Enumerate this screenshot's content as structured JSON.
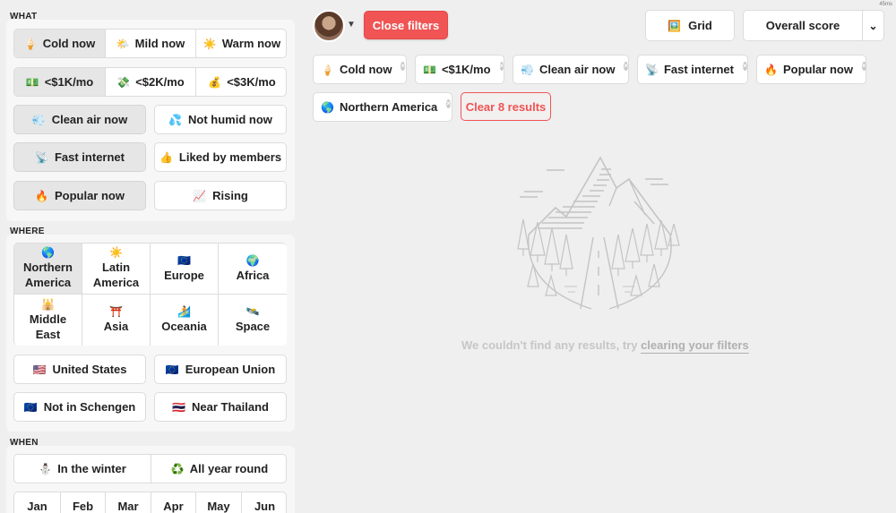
{
  "sidebar": {
    "what_label": "WHAT",
    "where_label": "WHERE",
    "when_label": "WHEN",
    "weather": [
      {
        "emoji": "🍦",
        "label": "Cold now",
        "selected": true
      },
      {
        "emoji": "🌤️",
        "label": "Mild now",
        "selected": false
      },
      {
        "emoji": "☀️",
        "label": "Warm now",
        "selected": false
      }
    ],
    "cost": [
      {
        "emoji": "💵",
        "label": "<$1K/mo",
        "selected": true
      },
      {
        "emoji": "💸",
        "label": "<$2K/mo",
        "selected": false
      },
      {
        "emoji": "💰",
        "label": "<$3K/mo",
        "selected": false
      }
    ],
    "what_buttons": [
      {
        "emoji": "💨",
        "label": "Clean air now",
        "selected": true
      },
      {
        "emoji": "💦",
        "label": "Not humid now",
        "selected": false
      },
      {
        "emoji": "📡",
        "label": "Fast internet",
        "selected": true
      },
      {
        "emoji": "👍",
        "label": "Liked by members",
        "selected": false
      },
      {
        "emoji": "🔥",
        "label": "Popular now",
        "selected": true
      },
      {
        "emoji": "📈",
        "label": "Rising",
        "selected": false
      }
    ],
    "regions": [
      {
        "emoji": "🌎",
        "line1": "Northern",
        "line2": "America",
        "selected": true
      },
      {
        "emoji": "☀️",
        "line1": "Latin",
        "line2": "America",
        "selected": false
      },
      {
        "emoji": "🇪🇺",
        "line1": "Europe",
        "line2": "",
        "selected": false
      },
      {
        "emoji": "🌍",
        "line1": "Africa",
        "line2": "",
        "selected": false
      },
      {
        "emoji": "🕌",
        "line1": "Middle",
        "line2": "East",
        "selected": false
      },
      {
        "emoji": "⛩️",
        "line1": "Asia",
        "line2": "",
        "selected": false
      },
      {
        "emoji": "🏄",
        "line1": "Oceania",
        "line2": "",
        "selected": false
      },
      {
        "emoji": "🛰️",
        "line1": "Space",
        "line2": "",
        "selected": false
      }
    ],
    "where_buttons": [
      {
        "emoji": "🇺🇸",
        "label": "United States"
      },
      {
        "emoji": "🇪🇺",
        "label": "European Union"
      },
      {
        "emoji": "🇪🇺",
        "label": "Not in Schengen"
      },
      {
        "emoji": "🇹🇭",
        "label": "Near Thailand"
      }
    ],
    "season": [
      {
        "emoji": "⛄",
        "label": "In the winter"
      },
      {
        "emoji": "♻️",
        "label": "All year round"
      }
    ],
    "months": [
      "Jan",
      "Feb",
      "Mar",
      "Apr",
      "May",
      "Jun"
    ]
  },
  "header": {
    "close_filters": "Close filters",
    "view_emoji": "🖼️",
    "view_label": "Grid",
    "sort_label": "Overall score",
    "corner_text": "45ms"
  },
  "active_filters": [
    {
      "emoji": "🍦",
      "label": "Cold now"
    },
    {
      "emoji": "💵",
      "label": "<$1K/mo"
    },
    {
      "emoji": "💨",
      "label": "Clean air now"
    },
    {
      "emoji": "📡",
      "label": "Fast internet"
    },
    {
      "emoji": "🔥",
      "label": "Popular now"
    },
    {
      "emoji": "🌎",
      "label": "Northern America"
    }
  ],
  "clear_label": "Clear 8 results",
  "empty": {
    "message": "We couldn't find any results, try",
    "link": "clearing your filters"
  }
}
